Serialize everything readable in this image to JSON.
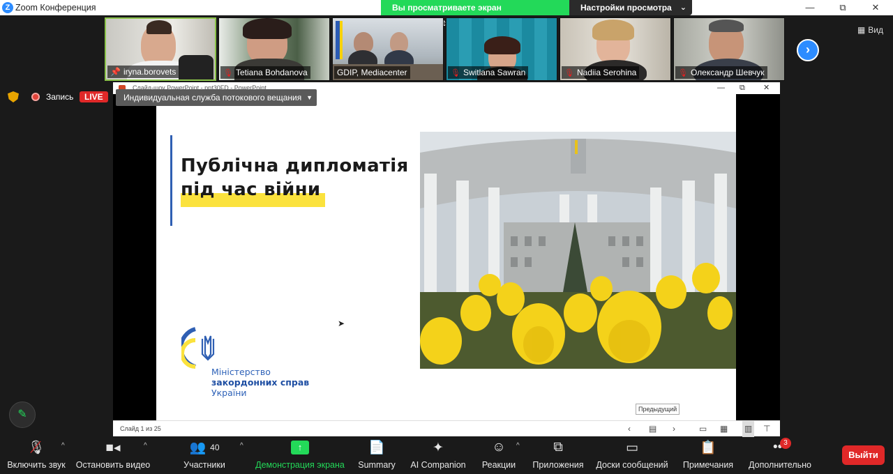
{
  "window": {
    "title": "Zoom Конференция",
    "minimize": "—",
    "maximize": "⧉",
    "close": "✕"
  },
  "share_banner": {
    "text": "Вы просматриваете экран iryna.borovets",
    "view_settings": "Настройки просмотра"
  },
  "view_button": "Вид",
  "participants": [
    {
      "name": "iryna.borovets",
      "muted": false
    },
    {
      "name": "Tetiana Bohdanova",
      "muted": true
    },
    {
      "name": "GDIP, Mediacenter",
      "muted": false
    },
    {
      "name": "Switlana Sawran",
      "muted": true
    },
    {
      "name": "Nadiia Serohina",
      "muted": true
    },
    {
      "name": "Олександр Шевчук",
      "muted": true
    }
  ],
  "recording": {
    "label": "Запись",
    "live": "LIVE"
  },
  "stream_service": "Индивидуальная служба потокового вещания",
  "ppt": {
    "window_title": "Слайд-шоу PowerPoint  -  ppt30FD - PowerPoint",
    "slide_title_line1": "Публічна дипломатія",
    "slide_title_line2": "під час війни",
    "ministry_line1": "Міністерство",
    "ministry_line2": "закордонних справ",
    "ministry_line3": "України",
    "prev_tooltip": "Предыдущий",
    "status": "Слайд 1 из 25"
  },
  "toolbar": {
    "audio": "Включить звук",
    "video": "Остановить видео",
    "participants": "Участники",
    "participants_count": "40",
    "share": "Демонстрация экрана",
    "summary": "Summary",
    "ai": "AI Companion",
    "reactions": "Реакции",
    "apps": "Приложения",
    "whiteboards": "Доски сообщений",
    "notes": "Примечания",
    "more": "Дополнительно",
    "more_badge": "3",
    "leave": "Выйти"
  },
  "colors": {
    "zoom_blue": "#2d8cff",
    "share_green": "#23d959",
    "live_red": "#e02828",
    "ukraine_yellow": "#fbe23d",
    "ukraine_blue": "#2f5fb3"
  }
}
